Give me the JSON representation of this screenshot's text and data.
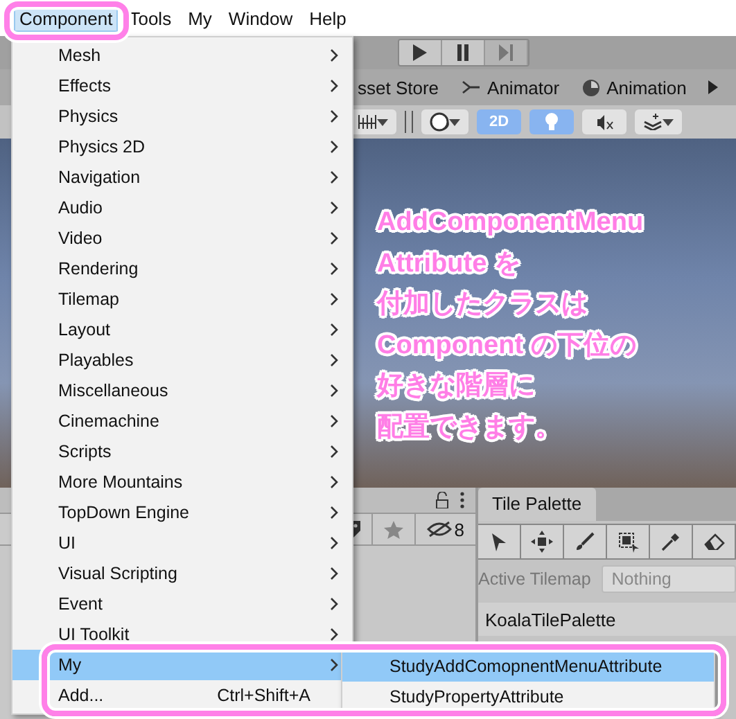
{
  "menubar": [
    {
      "label": "Component",
      "selected": true
    },
    {
      "label": "Tools",
      "selected": false
    },
    {
      "label": "My",
      "selected": false
    },
    {
      "label": "Window",
      "selected": false
    },
    {
      "label": "Help",
      "selected": false
    }
  ],
  "tabs": [
    {
      "label": "sset Store"
    },
    {
      "label": "Animator"
    },
    {
      "label": "Animation"
    }
  ],
  "scene_toolbar": {
    "mode_2d": {
      "label": "2D",
      "on": true
    },
    "lighting_on": true,
    "audio_muted": true
  },
  "annotation": {
    "lines": [
      "AddComponentMenu",
      "Attribute を",
      "付加したクラスは",
      "Component の下位の",
      "好きな階層に",
      "配置できます。"
    ]
  },
  "hierarchy": {
    "hidden_count": "8"
  },
  "tile_palette": {
    "tab": "Tile Palette",
    "active_tilemap_label": "Active Tilemap",
    "active_tilemap_value": "Nothing",
    "palette": "KoalaTilePalette"
  },
  "component_menu": {
    "items": [
      {
        "label": "Mesh",
        "submenu": true,
        "selected": false
      },
      {
        "label": "Effects",
        "submenu": true,
        "selected": false
      },
      {
        "label": "Physics",
        "submenu": true,
        "selected": false
      },
      {
        "label": "Physics 2D",
        "submenu": true,
        "selected": false
      },
      {
        "label": "Navigation",
        "submenu": true,
        "selected": false
      },
      {
        "label": "Audio",
        "submenu": true,
        "selected": false
      },
      {
        "label": "Video",
        "submenu": true,
        "selected": false
      },
      {
        "label": "Rendering",
        "submenu": true,
        "selected": false
      },
      {
        "label": "Tilemap",
        "submenu": true,
        "selected": false
      },
      {
        "label": "Layout",
        "submenu": true,
        "selected": false
      },
      {
        "label": "Playables",
        "submenu": true,
        "selected": false
      },
      {
        "label": "Miscellaneous",
        "submenu": true,
        "selected": false
      },
      {
        "label": "Cinemachine",
        "submenu": true,
        "selected": false
      },
      {
        "label": "Scripts",
        "submenu": true,
        "selected": false
      },
      {
        "label": "More Mountains",
        "submenu": true,
        "selected": false
      },
      {
        "label": "TopDown Engine",
        "submenu": true,
        "selected": false
      },
      {
        "label": "UI",
        "submenu": true,
        "selected": false
      },
      {
        "label": "Visual Scripting",
        "submenu": true,
        "selected": false
      },
      {
        "label": "Event",
        "submenu": true,
        "selected": false
      },
      {
        "label": "UI Toolkit",
        "submenu": true,
        "selected": false
      },
      {
        "label": "My",
        "submenu": true,
        "selected": true
      },
      {
        "label": "Add...",
        "shortcut": "Ctrl+Shift+A",
        "submenu": false,
        "selected": false
      }
    ]
  },
  "submenu": {
    "items": [
      {
        "label": "StudyAddComopnentMenuAttribute",
        "selected": true
      },
      {
        "label": "StudyPropertyAttribute",
        "selected": false
      }
    ]
  }
}
